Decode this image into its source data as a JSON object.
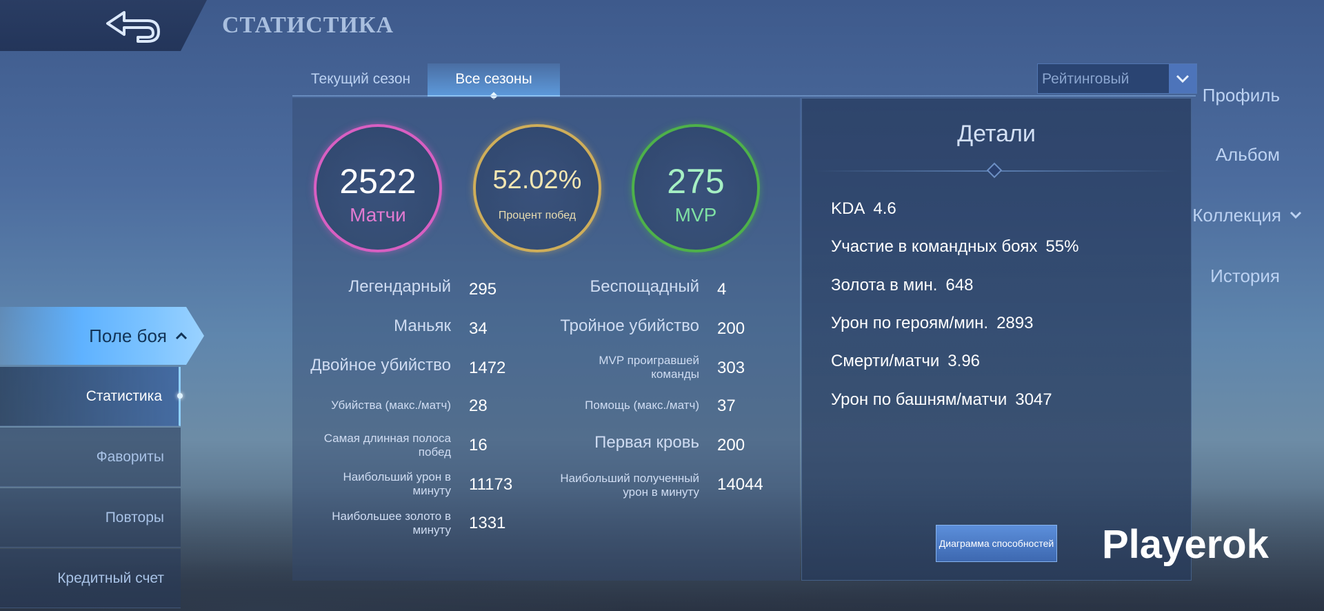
{
  "header": {
    "title": "СТАТИСТИКА"
  },
  "sidebar": {
    "items": [
      {
        "label": "Профиль"
      },
      {
        "label": "Альбом"
      },
      {
        "label": "Коллекция"
      },
      {
        "label": "История"
      },
      {
        "label": "Поле боя"
      }
    ],
    "subitems": [
      {
        "label": "Статистика"
      },
      {
        "label": "Фавориты"
      },
      {
        "label": "Повторы"
      },
      {
        "label": "Кредитный счет"
      }
    ]
  },
  "tabs": [
    {
      "label": "Текущий сезон"
    },
    {
      "label": "Все сезоны"
    }
  ],
  "dropdown": {
    "value": "Рейтинговый"
  },
  "rings": [
    {
      "value": "2522",
      "label": "Матчи",
      "color": "#d85fc2"
    },
    {
      "value": "52.02%",
      "label": "Процент побед",
      "color": "#cfae5a"
    },
    {
      "value": "275",
      "label": "MVP",
      "color": "#4eb14a"
    }
  ],
  "stats_left": [
    {
      "label": "Легендарный",
      "value": "295"
    },
    {
      "label": "Маньяк",
      "value": "34"
    },
    {
      "label": "Двойное убийство",
      "value": "1472"
    },
    {
      "label": "Убийства (макс./матч)",
      "value": "28"
    },
    {
      "label": "Самая длинная полоса побед",
      "value": "16"
    },
    {
      "label": "Наибольший урон в минуту",
      "value": "11173"
    },
    {
      "label": "Наибольшее золото в минуту",
      "value": "1331"
    }
  ],
  "stats_right": [
    {
      "label": "Беспощадный",
      "value": "4"
    },
    {
      "label": "Тройное убийство",
      "value": "200"
    },
    {
      "label": "MVP проигравшей команды",
      "value": "303"
    },
    {
      "label": "Помощь (макс./матч)",
      "value": "37"
    },
    {
      "label": "Первая кровь",
      "value": "200"
    },
    {
      "label": "Наибольший полученный урон в минуту",
      "value": "14044"
    }
  ],
  "details": {
    "title": "Детали",
    "rows": [
      {
        "label": "KDA",
        "value": "4.6"
      },
      {
        "label": "Участие в командных боях",
        "value": "55%"
      },
      {
        "label": "Золота в мин.",
        "value": "648"
      },
      {
        "label": "Урон по героям/мин.",
        "value": "2893"
      },
      {
        "label": "Смерти/матчи",
        "value": "3.96"
      },
      {
        "label": "Урон по башням/матчи",
        "value": "3047"
      }
    ],
    "button_label": "Диаграмма способностей"
  },
  "watermark": "Playerok",
  "icons": {
    "back": "back-arrow-icon",
    "chevron_down": "chevron-down-icon",
    "chevron_up": "chevron-up-icon",
    "dropdown": "dropdown-arrow-icon"
  }
}
